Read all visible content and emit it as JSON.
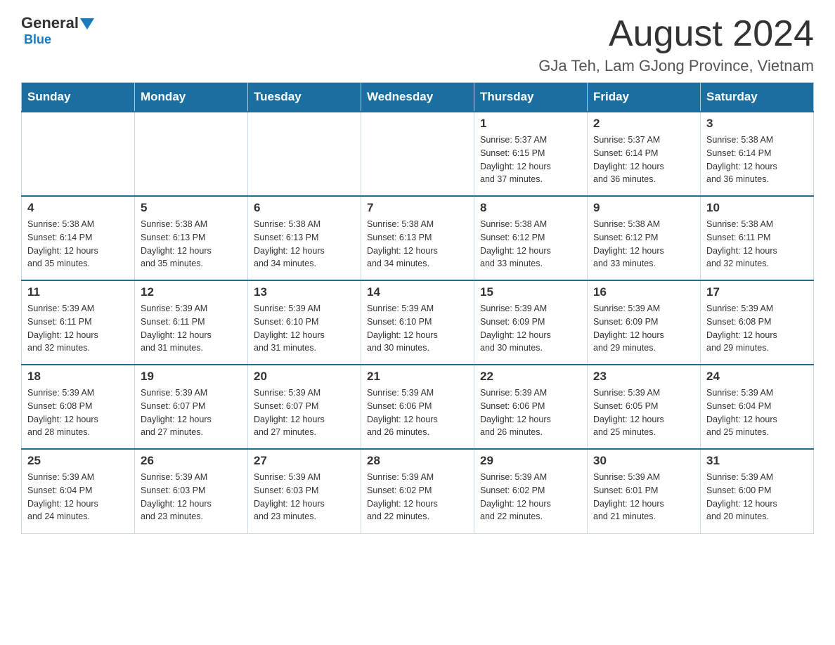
{
  "header": {
    "logo_general": "General",
    "logo_blue": "Blue",
    "title": "August 2024",
    "subtitle": "GJa Teh, Lam GJong Province, Vietnam"
  },
  "days_of_week": [
    "Sunday",
    "Monday",
    "Tuesday",
    "Wednesday",
    "Thursday",
    "Friday",
    "Saturday"
  ],
  "weeks": [
    [
      {
        "day": "",
        "info": ""
      },
      {
        "day": "",
        "info": ""
      },
      {
        "day": "",
        "info": ""
      },
      {
        "day": "",
        "info": ""
      },
      {
        "day": "1",
        "info": "Sunrise: 5:37 AM\nSunset: 6:15 PM\nDaylight: 12 hours\nand 37 minutes."
      },
      {
        "day": "2",
        "info": "Sunrise: 5:37 AM\nSunset: 6:14 PM\nDaylight: 12 hours\nand 36 minutes."
      },
      {
        "day": "3",
        "info": "Sunrise: 5:38 AM\nSunset: 6:14 PM\nDaylight: 12 hours\nand 36 minutes."
      }
    ],
    [
      {
        "day": "4",
        "info": "Sunrise: 5:38 AM\nSunset: 6:14 PM\nDaylight: 12 hours\nand 35 minutes."
      },
      {
        "day": "5",
        "info": "Sunrise: 5:38 AM\nSunset: 6:13 PM\nDaylight: 12 hours\nand 35 minutes."
      },
      {
        "day": "6",
        "info": "Sunrise: 5:38 AM\nSunset: 6:13 PM\nDaylight: 12 hours\nand 34 minutes."
      },
      {
        "day": "7",
        "info": "Sunrise: 5:38 AM\nSunset: 6:13 PM\nDaylight: 12 hours\nand 34 minutes."
      },
      {
        "day": "8",
        "info": "Sunrise: 5:38 AM\nSunset: 6:12 PM\nDaylight: 12 hours\nand 33 minutes."
      },
      {
        "day": "9",
        "info": "Sunrise: 5:38 AM\nSunset: 6:12 PM\nDaylight: 12 hours\nand 33 minutes."
      },
      {
        "day": "10",
        "info": "Sunrise: 5:38 AM\nSunset: 6:11 PM\nDaylight: 12 hours\nand 32 minutes."
      }
    ],
    [
      {
        "day": "11",
        "info": "Sunrise: 5:39 AM\nSunset: 6:11 PM\nDaylight: 12 hours\nand 32 minutes."
      },
      {
        "day": "12",
        "info": "Sunrise: 5:39 AM\nSunset: 6:11 PM\nDaylight: 12 hours\nand 31 minutes."
      },
      {
        "day": "13",
        "info": "Sunrise: 5:39 AM\nSunset: 6:10 PM\nDaylight: 12 hours\nand 31 minutes."
      },
      {
        "day": "14",
        "info": "Sunrise: 5:39 AM\nSunset: 6:10 PM\nDaylight: 12 hours\nand 30 minutes."
      },
      {
        "day": "15",
        "info": "Sunrise: 5:39 AM\nSunset: 6:09 PM\nDaylight: 12 hours\nand 30 minutes."
      },
      {
        "day": "16",
        "info": "Sunrise: 5:39 AM\nSunset: 6:09 PM\nDaylight: 12 hours\nand 29 minutes."
      },
      {
        "day": "17",
        "info": "Sunrise: 5:39 AM\nSunset: 6:08 PM\nDaylight: 12 hours\nand 29 minutes."
      }
    ],
    [
      {
        "day": "18",
        "info": "Sunrise: 5:39 AM\nSunset: 6:08 PM\nDaylight: 12 hours\nand 28 minutes."
      },
      {
        "day": "19",
        "info": "Sunrise: 5:39 AM\nSunset: 6:07 PM\nDaylight: 12 hours\nand 27 minutes."
      },
      {
        "day": "20",
        "info": "Sunrise: 5:39 AM\nSunset: 6:07 PM\nDaylight: 12 hours\nand 27 minutes."
      },
      {
        "day": "21",
        "info": "Sunrise: 5:39 AM\nSunset: 6:06 PM\nDaylight: 12 hours\nand 26 minutes."
      },
      {
        "day": "22",
        "info": "Sunrise: 5:39 AM\nSunset: 6:06 PM\nDaylight: 12 hours\nand 26 minutes."
      },
      {
        "day": "23",
        "info": "Sunrise: 5:39 AM\nSunset: 6:05 PM\nDaylight: 12 hours\nand 25 minutes."
      },
      {
        "day": "24",
        "info": "Sunrise: 5:39 AM\nSunset: 6:04 PM\nDaylight: 12 hours\nand 25 minutes."
      }
    ],
    [
      {
        "day": "25",
        "info": "Sunrise: 5:39 AM\nSunset: 6:04 PM\nDaylight: 12 hours\nand 24 minutes."
      },
      {
        "day": "26",
        "info": "Sunrise: 5:39 AM\nSunset: 6:03 PM\nDaylight: 12 hours\nand 23 minutes."
      },
      {
        "day": "27",
        "info": "Sunrise: 5:39 AM\nSunset: 6:03 PM\nDaylight: 12 hours\nand 23 minutes."
      },
      {
        "day": "28",
        "info": "Sunrise: 5:39 AM\nSunset: 6:02 PM\nDaylight: 12 hours\nand 22 minutes."
      },
      {
        "day": "29",
        "info": "Sunrise: 5:39 AM\nSunset: 6:02 PM\nDaylight: 12 hours\nand 22 minutes."
      },
      {
        "day": "30",
        "info": "Sunrise: 5:39 AM\nSunset: 6:01 PM\nDaylight: 12 hours\nand 21 minutes."
      },
      {
        "day": "31",
        "info": "Sunrise: 5:39 AM\nSunset: 6:00 PM\nDaylight: 12 hours\nand 20 minutes."
      }
    ]
  ]
}
